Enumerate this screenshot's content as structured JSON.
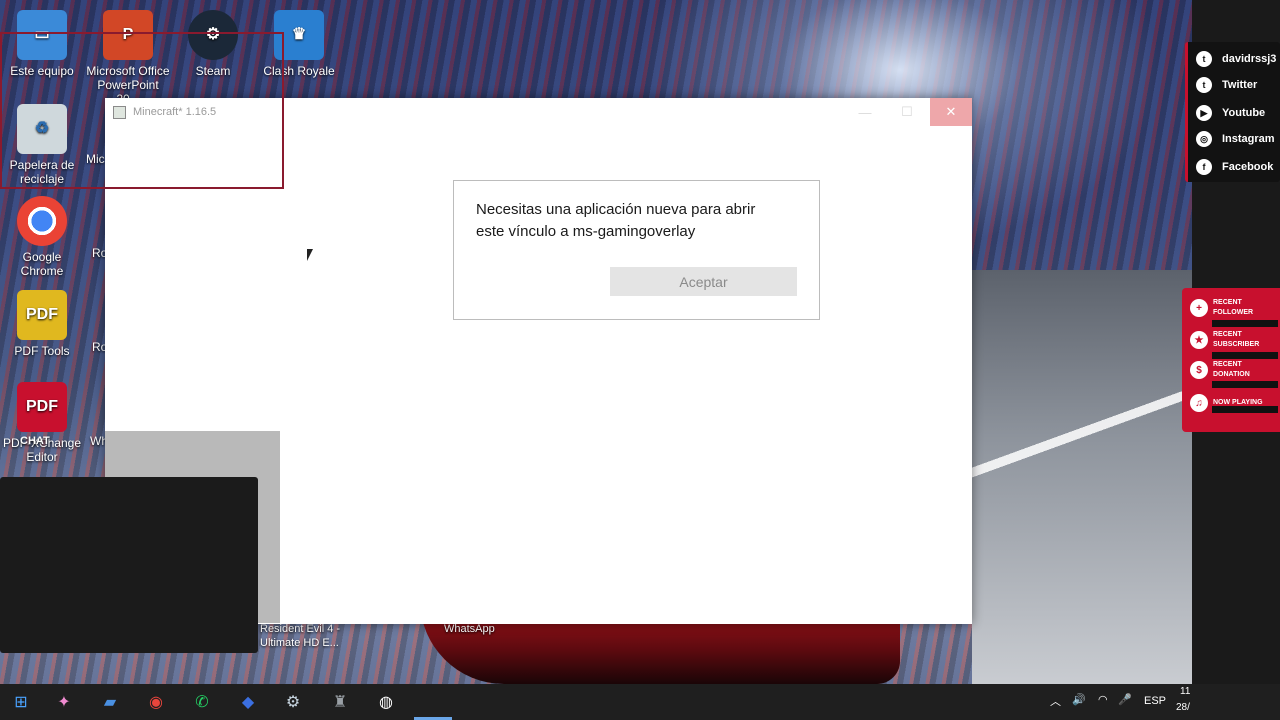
{
  "desktop": {
    "icons": [
      {
        "label": "Este equipo",
        "icon": "pc-icon",
        "color": "#3b8ad8"
      },
      {
        "label": "Microsoft Office PowerPoint 20...",
        "icon": "powerpoint-icon",
        "color": "#d24726"
      },
      {
        "label": "Steam",
        "icon": "steam-icon",
        "color": "#1b2838"
      },
      {
        "label": "Clash Royale",
        "icon": "clash-royale-icon",
        "color": "#2a7fd0"
      },
      {
        "label": "Papelera de reciclaje",
        "icon": "recycle-bin-icon",
        "color": "#cfd8dc"
      },
      {
        "label": "Mic",
        "icon": "app-icon",
        "color": "#d24726"
      },
      {
        "label": "Google Chrome",
        "icon": "chrome-icon",
        "color": "#ffffff"
      },
      {
        "label": "Ro",
        "icon": "app-icon",
        "color": "#555555"
      },
      {
        "label": "PDF Tools",
        "icon": "pdf-tools-icon",
        "color": "#e0b81f"
      },
      {
        "label": "Ro",
        "icon": "app-icon",
        "color": "#555555"
      },
      {
        "label": "PDF-XChange Editor",
        "icon": "pdf-editor-icon",
        "color": "#c8102e"
      },
      {
        "label": "Wh",
        "icon": "app-icon",
        "color": "#555555"
      }
    ],
    "bottom_labels": [
      "Resident Evil 4 - Ultimate HD E...",
      "WhatsApp"
    ]
  },
  "window": {
    "title": "Minecraft* 1.16.5",
    "minimize": "—",
    "maximize": "☐",
    "close": "✕"
  },
  "dialog": {
    "message": "Necesitas una aplicación nueva para abrir este vínculo a ms-gamingoverlay",
    "button": "Aceptar"
  },
  "overlay": {
    "chat_label": "CHAT",
    "social": [
      {
        "label": "davidrssj3",
        "icon": "twitch-icon",
        "glyph": "t"
      },
      {
        "label": "Twitter",
        "icon": "twitter-icon",
        "glyph": "t"
      },
      {
        "label": "Youtube",
        "icon": "youtube-icon",
        "glyph": "▶"
      },
      {
        "label": "Instagram",
        "icon": "instagram-icon",
        "glyph": "◎"
      },
      {
        "label": "Facebook",
        "icon": "facebook-icon",
        "glyph": "f"
      }
    ],
    "recent": [
      {
        "label": "RECENT FOLLOWER",
        "icon": "follower-icon",
        "glyph": "+"
      },
      {
        "label": "RECENT SUBSCRIBER",
        "icon": "subscriber-icon",
        "glyph": "★"
      },
      {
        "label": "RECENT DONATION",
        "icon": "donation-icon",
        "glyph": "$"
      },
      {
        "label": "NOW PLAYING",
        "icon": "music-icon",
        "glyph": "♫"
      }
    ],
    "accent": "#c8102e"
  },
  "taskbar": {
    "apps": [
      {
        "name": "windows-start-icon",
        "glyph": "⊞",
        "color": "#4aa3ff"
      },
      {
        "name": "copilot-icon",
        "glyph": "✦",
        "color": "#f08bd0"
      },
      {
        "name": "file-explorer-icon",
        "glyph": "▰",
        "color": "#4a90e2"
      },
      {
        "name": "chrome-taskbar-icon",
        "glyph": "◉",
        "color": "#e8453c"
      },
      {
        "name": "whatsapp-taskbar-icon",
        "glyph": "✆",
        "color": "#25d366"
      },
      {
        "name": "roblox-taskbar-icon",
        "glyph": "◆",
        "color": "#3b6fe0"
      },
      {
        "name": "steam-taskbar-icon",
        "glyph": "⚙",
        "color": "#c7d5e0"
      },
      {
        "name": "minecraft-dungeons-taskbar-icon",
        "glyph": "♜",
        "color": "#9aa0a6"
      },
      {
        "name": "obs-taskbar-icon",
        "glyph": "◍",
        "color": "#ffffff"
      }
    ],
    "tray": {
      "chevron": "︿",
      "volume": "🔊",
      "wifi": "◠",
      "mic": "🎤",
      "language": "ESP",
      "time": "11",
      "date": "28/"
    }
  }
}
